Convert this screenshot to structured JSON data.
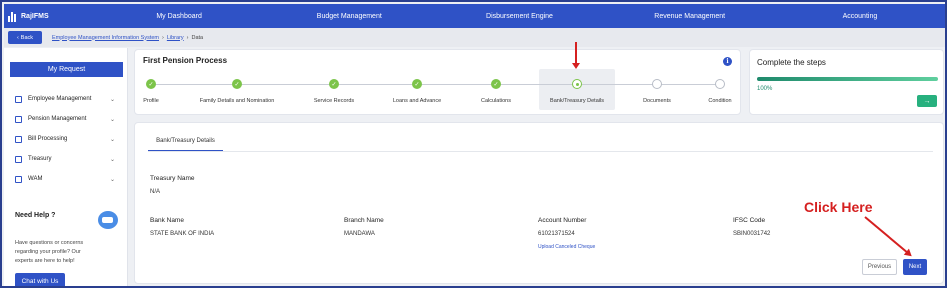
{
  "app": {
    "name": "RajIFMS"
  },
  "nav": {
    "items": [
      {
        "label": "My Dashboard"
      },
      {
        "label": "Budget Management"
      },
      {
        "label": "Disbursement Engine"
      },
      {
        "label": "Revenue Management"
      },
      {
        "label": "Accounting"
      }
    ]
  },
  "breadcrumb": {
    "back_label": "Back",
    "items": [
      "Employee Management Information System",
      "Library",
      "Data"
    ]
  },
  "sidebar": {
    "my_request_label": "My Request",
    "items": [
      {
        "label": "Employee Management"
      },
      {
        "label": "Pension Management"
      },
      {
        "label": "Bill Processing"
      },
      {
        "label": "Treasury"
      },
      {
        "label": "WAM"
      }
    ],
    "help_title": "Need Help ?",
    "help_text": "Have questions or concerns regarding your profile? Our experts are here to help!",
    "chat_label": "Chat with Us"
  },
  "process": {
    "title": "First Pension Process",
    "info_glyph": "i",
    "steps": [
      {
        "label": "Profile",
        "state": "done"
      },
      {
        "label": "Family Details and Nomination",
        "state": "done"
      },
      {
        "label": "Service Records",
        "state": "done"
      },
      {
        "label": "Loans and Advance",
        "state": "done"
      },
      {
        "label": "Calculations",
        "state": "done"
      },
      {
        "label": "Bank/Treasury Details",
        "state": "current"
      },
      {
        "label": "Documents",
        "state": "todo"
      },
      {
        "label": "Condition",
        "state": "todo"
      }
    ]
  },
  "complete": {
    "title": "Complete the steps",
    "percent_label": "100%",
    "progress_fraction": 1.0,
    "go_glyph": "→"
  },
  "detail": {
    "tab_label": "Bank/Treasury Details",
    "treasury_name_label": "Treasury Name",
    "treasury_name_value": "N/A",
    "bank_name_label": "Bank Name",
    "bank_name_value": "STATE BANK OF INDIA",
    "branch_name_label": "Branch Name",
    "branch_name_value": "MANDAWA",
    "account_number_label": "Account Number",
    "account_number_value": "61021371524",
    "upload_link": "Upload Canceled Cheque",
    "ifsc_label": "IFSC Code",
    "ifsc_value": "SBIN0031742",
    "previous_label": "Previous",
    "next_label": "Next"
  },
  "annotation": {
    "click_here": "Click Here"
  },
  "colors": {
    "primary": "#2f52c6",
    "success": "#7cc44a",
    "annotation": "#d52020"
  }
}
